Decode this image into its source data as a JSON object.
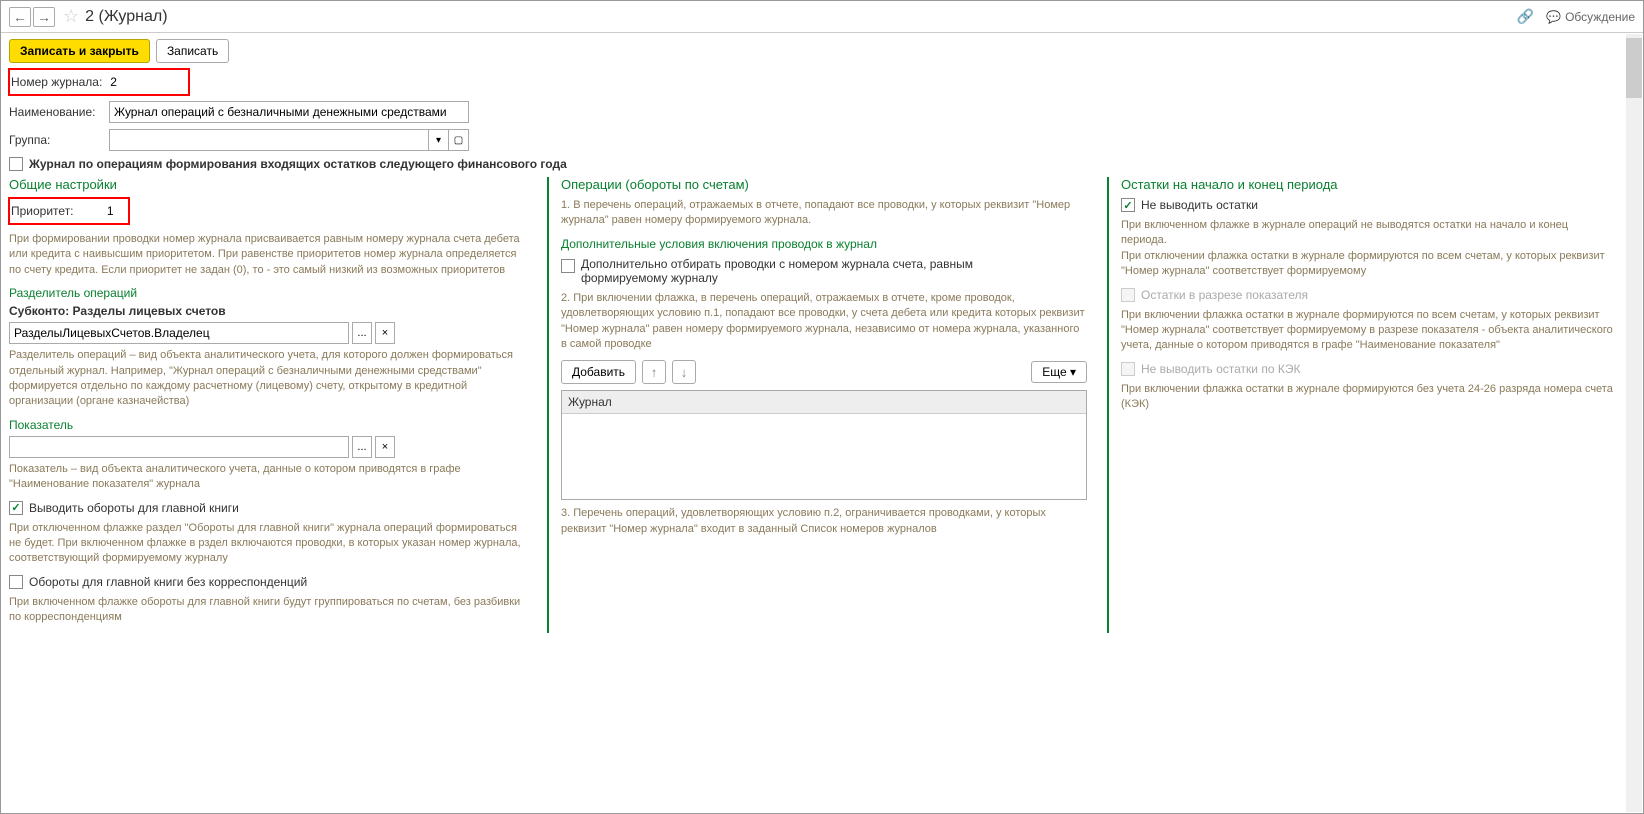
{
  "title": "2 (Журнал)",
  "discuss_label": "Обсуждение",
  "toolbar": {
    "save_close": "Записать и закрыть",
    "save": "Записать"
  },
  "form": {
    "journal_number_label": "Номер журнала:",
    "journal_number_value": "2",
    "name_label": "Наименование:",
    "name_value": "Журнал операций с безналичными денежными средствами",
    "group_label": "Группа:",
    "group_value": "",
    "incoming_balance_label": "Журнал по операциям формирования входящих остатков следующего финансового года"
  },
  "col1": {
    "title": "Общие настройки",
    "priority_label": "Приоритет:",
    "priority_value": "1",
    "priority_help": "При формировании проводки номер журнала присваивается равным номеру журнала счета дебета или кредита с наивысшим приоритетом. При равенстве приоритетов номер журнала определяется по счету кредита. Если приоритет не задан (0), то - это самый низкий из возможных приоритетов",
    "divider_title": "Разделитель операций",
    "subkonto_title": "Субконто: Разделы лицевых счетов",
    "subkonto_value": "РазделыЛицевыхСчетов.Владелец",
    "divider_help": "Разделитель операций – вид объекта аналитического учета, для которого должен формироваться отдельный журнал. Например, \"Журнал операций с безналичными денежными средствами\" формируется отдельно по каждому расчетному (лицевому) счету, открытому в кредитной организации (органе казначейства)",
    "indicator_title": "Показатель",
    "indicator_value": "",
    "indicator_help": "Показатель – вид объекта аналитического учета, данные о котором приводятся в графе \"Наименование показателя\" журнала",
    "show_turnover_label": "Выводить обороты для главной книги",
    "show_turnover_help": "При отключенном флажке раздел \"Обороты для главной книги\" журнала операций формироваться не будет. При включенном флажке в рздел включаются проводки, в которых указан номер журнала, соответствующий формируемому журналу",
    "turnover_no_corr_label": "Обороты для главной книги без корреспонденций",
    "turnover_no_corr_help": "При включенном флажке обороты для главной книги будут группироваться по счетам, без разбивки по корреспонденциям"
  },
  "col2": {
    "title": "Операции (обороты по счетам)",
    "text1": "1. В перечень операций, отражаемых в отчете, попадают все проводки, у которых реквизит \"Номер журнала\" равен номеру формируемого журнала.",
    "additional_title": "Дополнительные условия включения проводок в журнал",
    "additional_checkbox": "Дополнительно отбирать проводки с номером журнала счета, равным формируемому журналу",
    "text2": "2. При включении флажка, в перечень операций, отражаемых в отчете, кроме проводок, удовлетворяющих условию п.1, попадают все проводки, у счета дебета или кредита которых реквизит \"Номер журнала\" равен номеру формируемого журнала, независимо от номера журнала, указанного в самой проводке",
    "add_button": "Добавить",
    "more_button": "Еще",
    "table_header": "Журнал",
    "text3": "3. Перечень операций, удовлетворяющих условию п.2, ограничивается проводками, у которых реквизит \"Номер журнала\" входит в заданный Список номеров журналов"
  },
  "col3": {
    "title": "Остатки на начало и конец периода",
    "hide_balances_label": "Не выводить остатки",
    "hide_balances_help": "При включенном флажке в журнале операций не выводятся остатки на начало и конец периода.\nПри отключении флажка остатки в журнале формируются по всем счетам, у которых реквизит \"Номер журнала\" соответствует формируемому",
    "by_indicator_label": "Остатки в разрезе показателя",
    "by_indicator_help": "При включении флажка остатки в журнале формируются по всем счетам, у которых реквизит \"Номер журнала\" соответствует формируемому в разрезе показателя - объекта аналитического учета, данные о котором приводятся в графе \"Наименование показателя\"",
    "no_kek_label": "Не выводить остатки по КЭК",
    "no_kek_help": "При включении флажка остатки в журнале формируются без учета 24-26 разряда номера счета (КЭК)"
  }
}
